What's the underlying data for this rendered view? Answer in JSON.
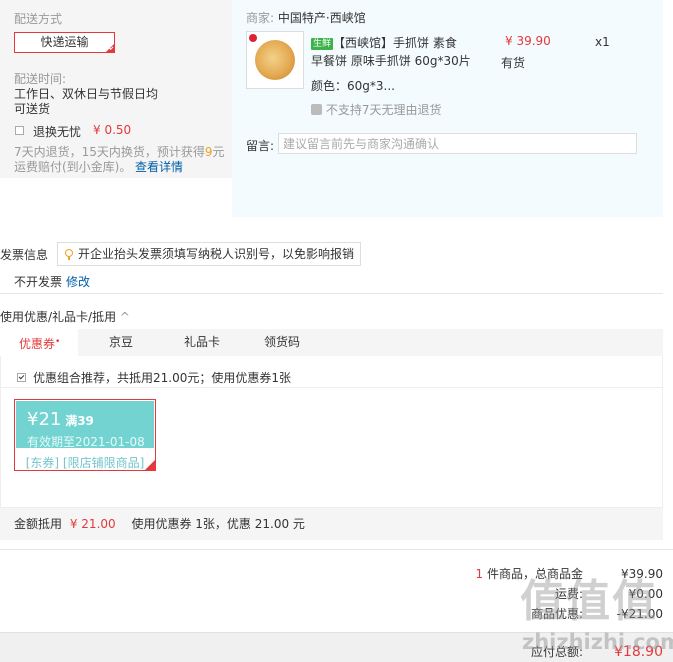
{
  "shipping": {
    "title": "配送方式",
    "method_button": "快递运输",
    "time_label": "配送时间:",
    "time_value_line1": "工作日、双休日与节假日均",
    "time_value_line2": "可送货",
    "insurance_label": "退换无忧",
    "insurance_price": "¥ 0.50",
    "insurance_desc_1": "7天内退货，15天内换货，预计获得",
    "insurance_desc_highlight": "9",
    "insurance_desc_2": "元",
    "insurance_desc_line2": "运费赔付(到小金库)。",
    "insurance_link": "查看详情"
  },
  "order": {
    "merchant_label": "商家:",
    "merchant_name": "中国特产·西峡馆",
    "fresh_tag": "生鲜",
    "product_title_line1": "【西峡馆】手抓饼 素食",
    "product_title_line2": "早餐饼 原味手抓饼 60g*30片",
    "price": "¥ 39.90",
    "quantity": "x1",
    "stock": "有货",
    "color_label": "颜色：60g*3...",
    "no_return": "不支持7天无理由退货",
    "message_label": "留言:",
    "message_placeholder": "建议留言前先与商家沟通确认"
  },
  "invoice": {
    "title": "发票信息",
    "tip": "开企业抬头发票须填写纳税人识别号，以免影响报销",
    "value": "不开发票",
    "edit_link": "修改"
  },
  "discount": {
    "title": "使用优惠/礼品卡/抵用",
    "chevron": "^",
    "tabs": [
      "优惠券",
      "京豆",
      "礼品卡",
      "领货码"
    ],
    "active_tab_mark": "•",
    "combo_text": "优惠组合推荐，共抵用21.00元；使用优惠券1张",
    "coupon": {
      "amount": "¥21",
      "condition": "满39",
      "expiry": "有效期至2021-01-08",
      "tags": "[东券] [限店铺限商品]"
    },
    "summary_label": "金额抵用",
    "summary_amount": "¥ 21.00",
    "summary_desc": "使用优惠券 1张，优惠 21.00 元"
  },
  "totals": {
    "items_count": "1",
    "items_label": "件商品，总商品金",
    "items_amount": "¥39.90",
    "freight_label": "运费:",
    "freight_amount": "¥0.00",
    "discount_label": "商品优惠:",
    "discount_amount": "-¥21.00",
    "payable_label": "应付总额:",
    "payable_amount": "¥18.90"
  },
  "watermark": {
    "text": "值值值",
    "site": "zhizhizhi.com"
  },
  "colors": {
    "accent_red": "#e4393c",
    "link_blue": "#005ea7",
    "coupon_teal": "#72d3d1",
    "fresh_green": "#3bb34a"
  }
}
